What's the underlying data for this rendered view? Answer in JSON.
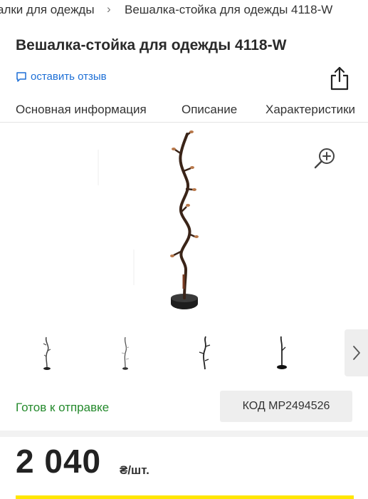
{
  "breadcrumb": {
    "parent": "алки для одежды",
    "separator": "›",
    "current": "Вешалка-стойка для одежды 4118-W"
  },
  "product": {
    "title": "Вешалка-стойка для одежды 4118-W",
    "review_link": "оставить отзыв",
    "status": "Готов к отправке",
    "code": "КОД MP2494526",
    "price": "2 040",
    "price_unit": "₴/шт."
  },
  "tabs": [
    {
      "label": "Основная информация"
    },
    {
      "label": "Описание"
    },
    {
      "label": "Характеристики"
    }
  ],
  "thumbnails": [
    {
      "icon": "coat-rack-thumbnail"
    },
    {
      "icon": "coat-rack-thumbnail"
    },
    {
      "icon": "coat-rack-thumbnail"
    },
    {
      "icon": "coat-rack-thumbnail"
    }
  ],
  "icons": {
    "share": "share-icon",
    "zoom": "zoom-in-icon",
    "review": "comment-icon",
    "next": "chevron-right-icon"
  },
  "colors": {
    "link": "#1d6fd6",
    "status": "#248a2c",
    "accent": "#ffe600"
  }
}
